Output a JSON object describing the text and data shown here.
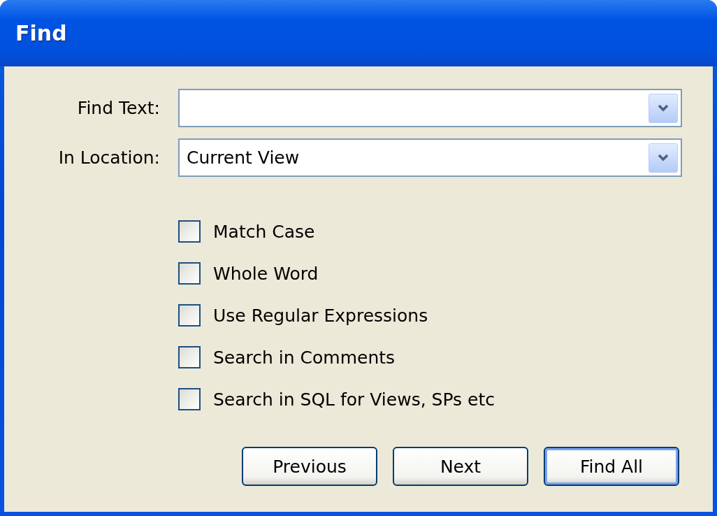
{
  "window": {
    "title": "Find"
  },
  "fields": [
    {
      "label": "Find Text:"
    },
    {
      "label": "In Location:",
      "value": "Current View"
    }
  ],
  "options": [
    {
      "label": "Match Case",
      "checked": false
    },
    {
      "label": "Whole Word",
      "checked": false
    },
    {
      "label": "Use Regular Expressions",
      "checked": false
    },
    {
      "label": "Search in Comments",
      "checked": false
    },
    {
      "label": "Search in SQL for Views, SPs etc",
      "checked": false
    }
  ],
  "buttons": [
    {
      "label": "Previous",
      "default": false
    },
    {
      "label": "Next",
      "default": false
    },
    {
      "label": "Find All",
      "default": true
    }
  ]
}
